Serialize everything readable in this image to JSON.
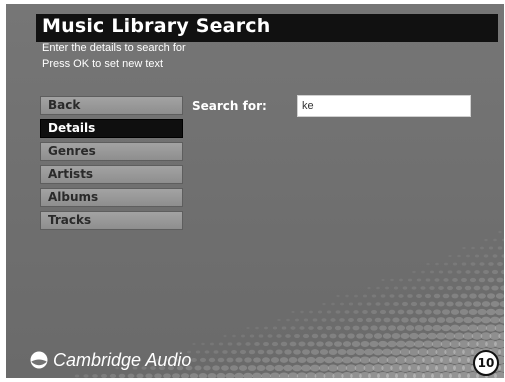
{
  "header": {
    "title": "Music Library Search",
    "instruction_1": "Enter the details to search for",
    "instruction_2": "Press OK to set new text"
  },
  "menu": {
    "items": [
      {
        "label": "Back",
        "selected": false
      },
      {
        "label": "Details",
        "selected": true
      },
      {
        "label": "Genres",
        "selected": false
      },
      {
        "label": "Artists",
        "selected": false
      },
      {
        "label": "Albums",
        "selected": false
      },
      {
        "label": "Tracks",
        "selected": false
      }
    ]
  },
  "search": {
    "label": "Search for:",
    "value": "ke"
  },
  "footer": {
    "brand": "Cambridge Audio",
    "logo_icon": "cambridge-audio-logo-icon",
    "page_number": "10"
  },
  "colors": {
    "background": "#737373",
    "title_bar": "#111111",
    "selected_item": "#0f0f0f",
    "menu_item": "#9a9a9a"
  }
}
